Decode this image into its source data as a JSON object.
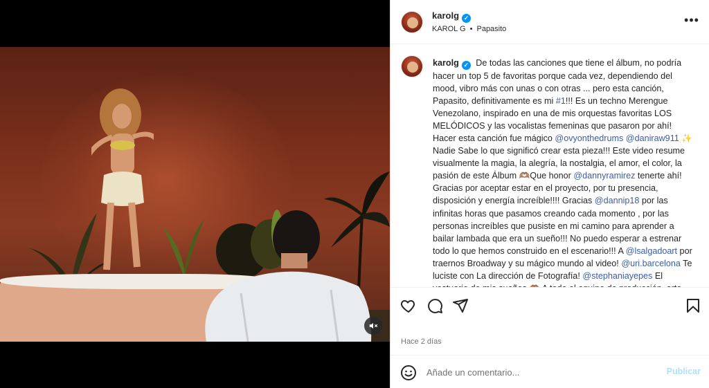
{
  "post": {
    "username": "karolg",
    "verified": true,
    "subtitle_artist": "KAROL G",
    "subtitle_separator": "•",
    "subtitle_song": "Papasito",
    "more_icon": "more-horizontal-icon"
  },
  "caption": {
    "username": "karolg",
    "segments": [
      {
        "t": "De todas las canciones que tiene el álbum, no podría hacer un top 5 de favoritas porque cada vez, dependiendo del mood, vibro más con unas o con otras ... pero esta canción, Papasito, definitivamente es mi ",
        "link": false
      },
      {
        "t": "#1",
        "link": true
      },
      {
        "t": "!!! Es un techno Merengue Venezolano, inspirado en una de mis orquestas favoritas LOS MELÓDICOS y las vocalistas femeninas que pasaron por ahí! Hacer esta canción fue mágico ",
        "link": false
      },
      {
        "t": "@ovyonthedrums",
        "link": true
      },
      {
        "t": " ",
        "link": false
      },
      {
        "t": "@daniraw911",
        "link": true
      },
      {
        "t": " ✨ Nadie Sabe lo que significó crear esta pieza!!! Este video resume visualmente la magia, la alegría, la nostalgia, el amor, el color, la pasión de este Álbum 🫶🏽Que honor ",
        "link": false
      },
      {
        "t": "@dannyramirez",
        "link": true
      },
      {
        "t": " tenerte ahí! Gracias por aceptar estar en el proyecto, por tu presencia, disposición y energía increíble!!!! Gracias ",
        "link": false
      },
      {
        "t": "@dannip18",
        "link": true
      },
      {
        "t": " por las infinitas horas que pasamos creando cada momento , por las personas increíbles que pusiste en mi camino para aprender a bailar lambada que era un sueño!!! No puedo esperar a estrenar todo lo que hemos construido en el escenario!!! A ",
        "link": false
      },
      {
        "t": "@lsalgadoart",
        "link": true
      },
      {
        "t": " por traernos Broadway y su mágico mundo al video! ",
        "link": false
      },
      {
        "t": "@uri.barcelona",
        "link": true
      },
      {
        "t": " Te luciste con La dirección de Fotografía! ",
        "link": false
      },
      {
        "t": "@stephaniayepes",
        "link": true
      },
      {
        "t": " El vestuario de mis sueños 🫶🏽 A todo el equipo de producción, arte , luces, glam , wardrobe y demás! A",
        "link": false
      }
    ]
  },
  "actions": {
    "like_icon": "heart-icon",
    "comment_icon": "comment-icon",
    "share_icon": "paper-plane-icon",
    "save_icon": "bookmark-icon"
  },
  "date": "Hace 2 días",
  "comment": {
    "placeholder": "Añade un comentario...",
    "post_label": "Publicar",
    "emoji_icon": "smiley-icon"
  },
  "media": {
    "mute_icon": "speaker-muted-icon"
  }
}
